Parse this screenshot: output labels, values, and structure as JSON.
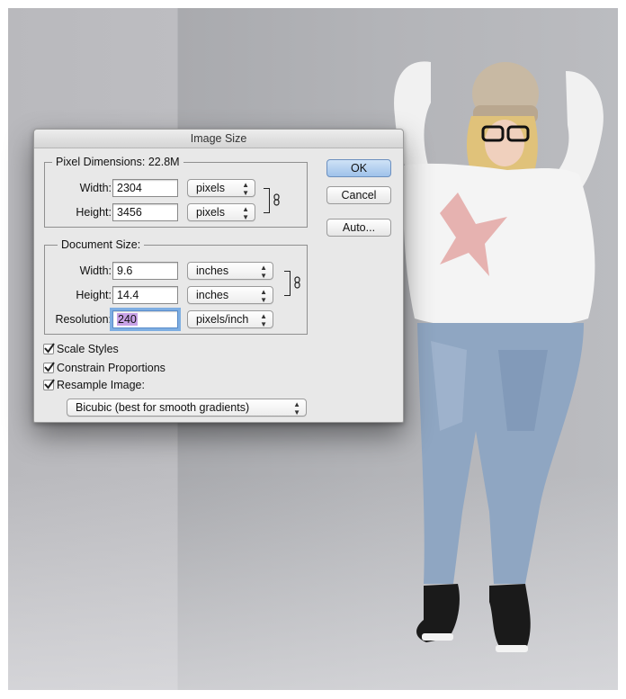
{
  "dialog": {
    "title": "Image Size",
    "buttons": {
      "ok": "OK",
      "cancel": "Cancel",
      "auto": "Auto..."
    },
    "pixel_dimensions": {
      "legend": "Pixel Dimensions:",
      "size": "22.8M",
      "width_label": "Width:",
      "width_value": "2304",
      "width_unit": "pixels",
      "height_label": "Height:",
      "height_value": "3456",
      "height_unit": "pixels"
    },
    "document_size": {
      "legend": "Document Size:",
      "width_label": "Width:",
      "width_value": "9.6",
      "width_unit": "inches",
      "height_label": "Height:",
      "height_value": "14.4",
      "height_unit": "inches",
      "resolution_label": "Resolution:",
      "resolution_value": "240",
      "resolution_unit": "pixels/inch"
    },
    "options": {
      "scale_styles": {
        "label": "Scale Styles",
        "checked": true
      },
      "constrain_proportions": {
        "label": "Constrain Proportions",
        "checked": true
      },
      "resample_image": {
        "label": "Resample Image:",
        "checked": true
      },
      "resample_method": "Bicubic (best for smooth gradients)"
    }
  },
  "icons": {
    "dropdown": "up-down-arrows-icon",
    "link": "chain-link-icon",
    "check": "checkmark-icon"
  },
  "colors": {
    "default_button": "#9fc2ea",
    "focus_ring": "#7eaee2",
    "selection": "#c8a2e6"
  }
}
